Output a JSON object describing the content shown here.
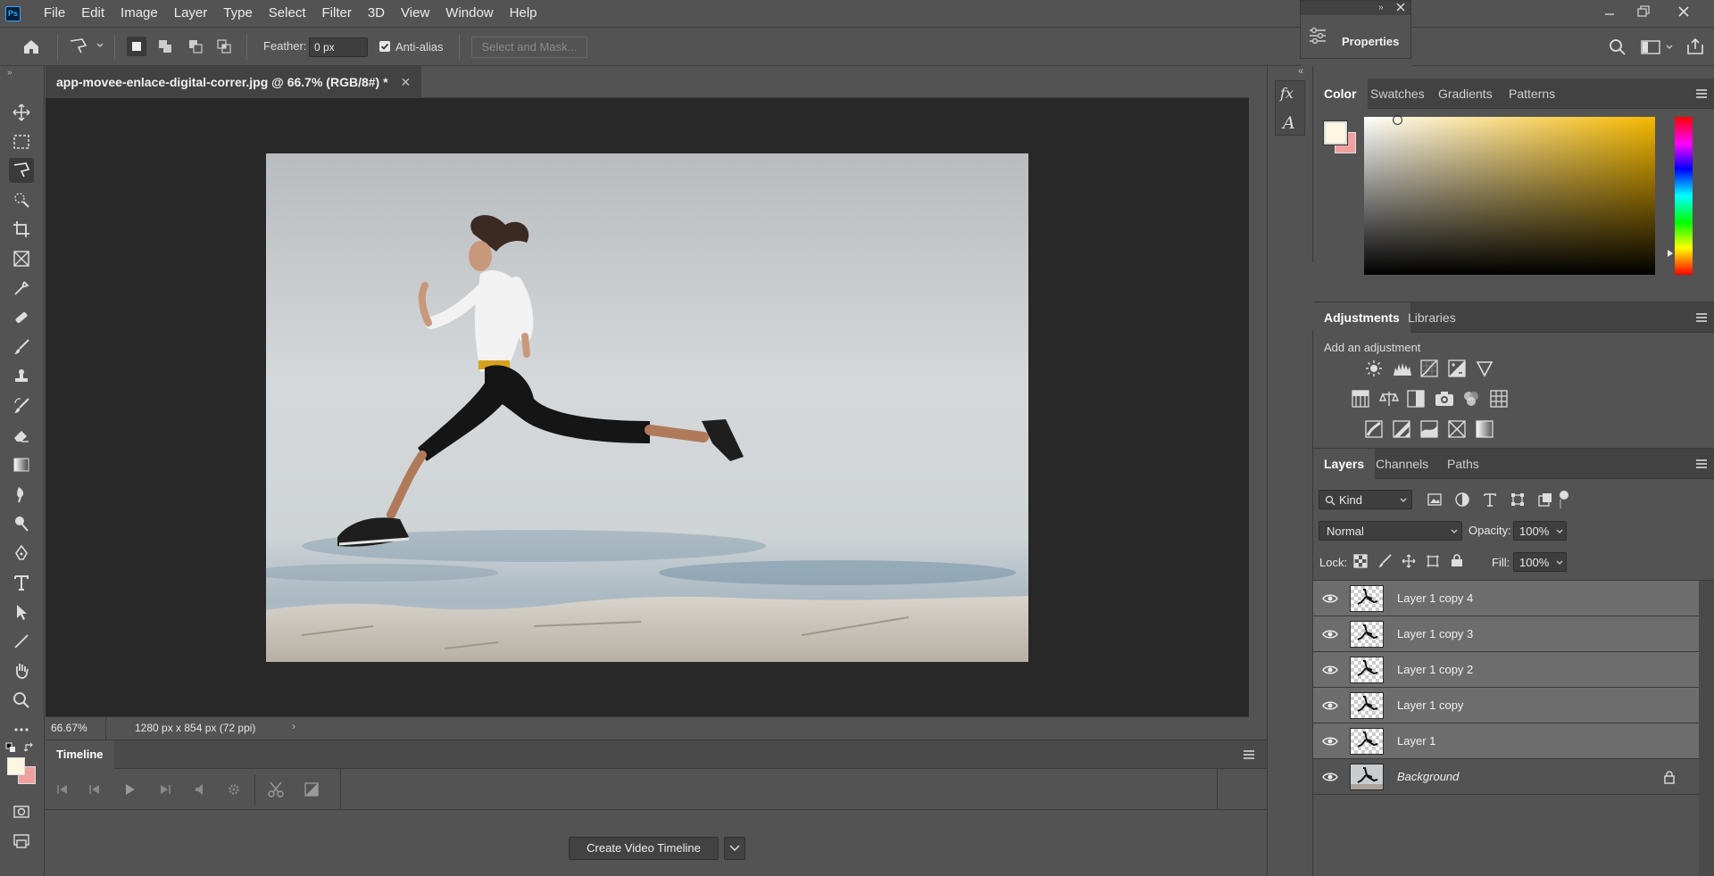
{
  "app": {
    "logo": "Ps"
  },
  "menu": [
    "File",
    "Edit",
    "Image",
    "Layer",
    "Type",
    "Select",
    "Filter",
    "3D",
    "View",
    "Window",
    "Help"
  ],
  "options": {
    "feather_label": "Feather:",
    "feather_value": "0 px",
    "antialias_label": "Anti-alias",
    "antialias_checked": true,
    "select_mask": "Select and Mask..."
  },
  "properties": {
    "label": "Properties"
  },
  "document": {
    "tab_title": "app-movee-enlace-digital-correr.jpg @ 66.7% (RGB/8#) *",
    "zoom": "66.67%",
    "info": "1280 px x 854 px (72 ppi)"
  },
  "timeline": {
    "title": "Timeline",
    "create_button": "Create Video Timeline"
  },
  "color_panel": {
    "tabs": [
      "Color",
      "Swatches",
      "Gradients",
      "Patterns"
    ],
    "foreground": "#fdf6e3",
    "background": "#f0a0a0",
    "hue_color": "#f5b800"
  },
  "adjustments_panel": {
    "tabs": [
      "Adjustments",
      "Libraries"
    ],
    "hint": "Add an adjustment"
  },
  "layers_panel": {
    "tabs": [
      "Layers",
      "Channels",
      "Paths"
    ],
    "filter_kind": "Kind",
    "blend_mode": "Normal",
    "opacity_label": "Opacity:",
    "opacity_value": "100%",
    "lock_label": "Lock:",
    "fill_label": "Fill:",
    "fill_value": "100%",
    "layers": [
      {
        "name": "Layer 1 copy 4"
      },
      {
        "name": "Layer 1 copy 3"
      },
      {
        "name": "Layer 1 copy 2"
      },
      {
        "name": "Layer 1 copy"
      },
      {
        "name": "Layer 1"
      },
      {
        "name": "Background"
      }
    ]
  }
}
